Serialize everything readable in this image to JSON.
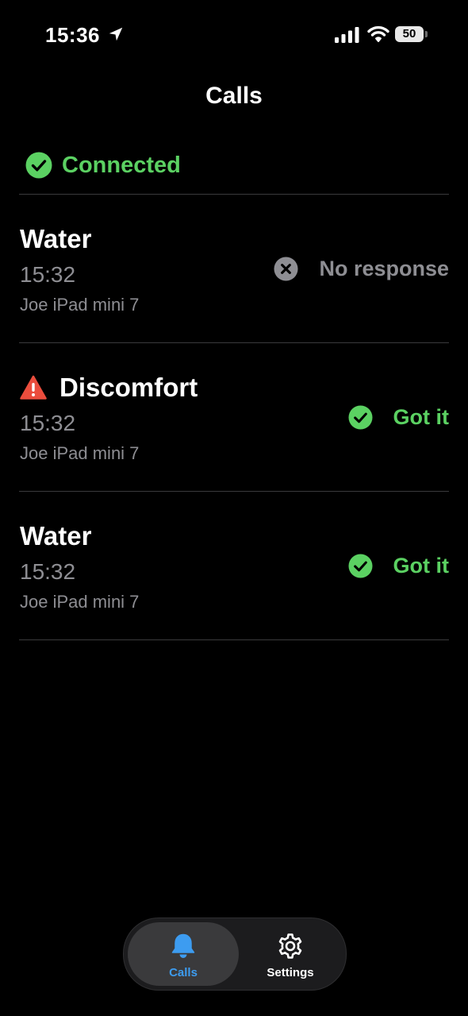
{
  "status_bar": {
    "time": "15:36",
    "battery": "50"
  },
  "page": {
    "title": "Calls"
  },
  "connection": {
    "label": "Connected",
    "color": "#5bd162"
  },
  "calls": [
    {
      "title": "Water",
      "time": "15:32",
      "device": "Joe iPad mini 7",
      "status": "No response",
      "status_icon": "x-circle-icon",
      "warning": false
    },
    {
      "title": "Discomfort",
      "time": "15:32",
      "device": "Joe iPad mini 7",
      "status": "Got it",
      "status_icon": "check-circle-icon",
      "warning": true
    },
    {
      "title": "Water",
      "time": "15:32",
      "device": "Joe iPad mini 7",
      "status": "Got it",
      "status_icon": "check-circle-icon",
      "warning": false
    }
  ],
  "tab_bar": {
    "tabs": [
      {
        "label": "Calls",
        "icon": "bell-icon",
        "active": true
      },
      {
        "label": "Settings",
        "icon": "gear-icon",
        "active": false
      }
    ]
  },
  "colors": {
    "accent_green": "#5bd162",
    "accent_blue": "#3d9cf0",
    "warning_red": "#eb4d3d",
    "secondary_text": "#8e8e93"
  }
}
